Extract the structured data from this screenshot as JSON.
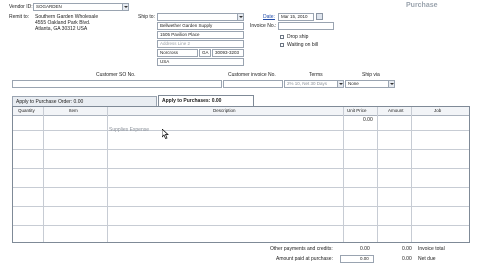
{
  "header": {
    "vendor_label": "Vendor ID:",
    "vendor_value": "SOGARDEN",
    "window_title": "Purchase"
  },
  "remit": {
    "label": "Remit to:",
    "lines": [
      "Southern Garden Wholesale",
      "4555 Oakland Park Blvd.",
      "Atlanta, GA 30312 USA"
    ]
  },
  "ship_to": {
    "label": "Ship to:",
    "name": "Bellwether Garden Supply",
    "address1": "1505 Pavilion Place",
    "address2_placeholder": "Address Line 2",
    "city": "Norcross",
    "state": "GA",
    "zip": "30093-3203",
    "country": "USA"
  },
  "doc": {
    "date_label": "Date:",
    "date_value": "Mar 15, 2010",
    "invoice_label": "Invoice No.:",
    "invoice_value": "",
    "drop_ship": "Drop ship",
    "waiting_on_bill": "Waiting on bill"
  },
  "terms_row": {
    "customer_so_label": "Customer SO No.",
    "customer_invoice_label": "Customer invoice No.",
    "terms_label": "Terms",
    "terms_value": "2% 10, Net 30 Days",
    "ship_via_label": "Ship via",
    "ship_via_value": "None"
  },
  "tabs": {
    "apply_po": "Apply to Purchase Order: 0.00",
    "apply_purchases": "Apply to Purchases: 0.00"
  },
  "grid": {
    "col_quantity": "Quantity",
    "col_item": "Item",
    "col_description": "Description",
    "col_unit_price": "Unit Price",
    "col_amount": "Amount",
    "col_job": "Job",
    "row1_unit_price": "0.00",
    "row1_account_desc": "Supplies Expense"
  },
  "totals": {
    "other_label": "Other payments and credits:",
    "other_value": "0.00",
    "invoice_total_value": "0.00",
    "invoice_total_label": "Invoice total",
    "paid_label": "Amount paid at purchase:",
    "paid_value": "0.00",
    "net_due_value": "0.00",
    "net_due_label": "Net due"
  }
}
